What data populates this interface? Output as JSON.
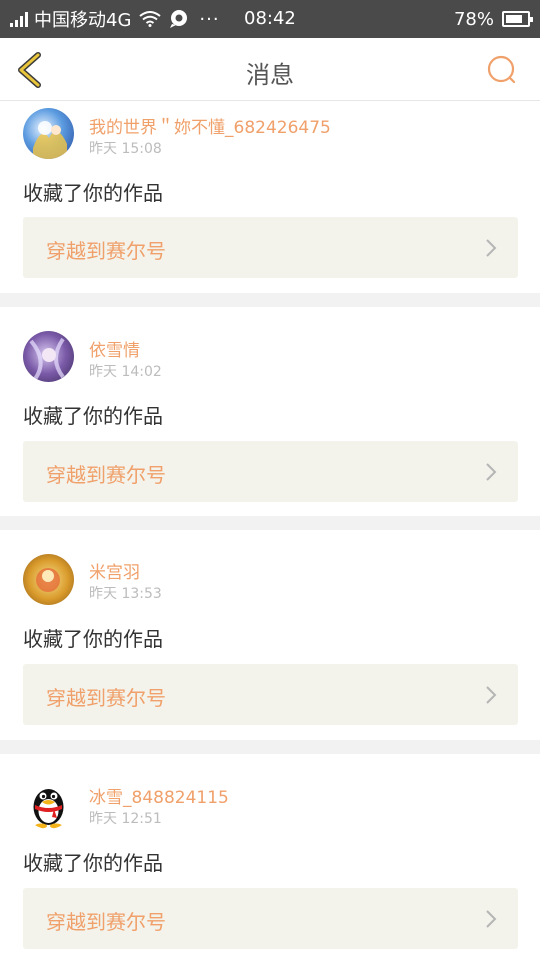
{
  "status_bar": {
    "carrier": "中国移动4G",
    "dots": "···",
    "time": "08:42",
    "battery": "78%",
    "battery_level": 0.78,
    "icons": [
      "signal-icon",
      "wifi-icon",
      "message-icon",
      "battery-icon"
    ]
  },
  "nav": {
    "title": "消息",
    "back_icon": "back-chevron-icon",
    "search_icon": "search-icon"
  },
  "colors": {
    "accent": "#f0a06a",
    "status_bar_bg": "#4a4a4a",
    "link_box_bg": "#f3f3ec",
    "separator": "#f2f2f2",
    "back_icon": "#e8c53a"
  },
  "messages": [
    {
      "username": "我的世界＂妳不懂_682426475",
      "time": "昨天 15:08",
      "action": "收藏了你的作品",
      "link": "穿越到赛尔号",
      "avatar": "avatar-anime-blue"
    },
    {
      "username": "依雪情",
      "time": "昨天 14:02",
      "action": "收藏了你的作品",
      "link": "穿越到赛尔号",
      "avatar": "avatar-anime-purple"
    },
    {
      "username": "米宫羽",
      "time": "昨天 13:53",
      "action": "收藏了你的作品",
      "link": "穿越到赛尔号",
      "avatar": "avatar-anime-gold"
    },
    {
      "username": "冰雪_848824115",
      "time": "昨天 12:51",
      "action": "收藏了你的作品",
      "link": "穿越到赛尔号",
      "avatar": "avatar-qq-penguin"
    }
  ]
}
